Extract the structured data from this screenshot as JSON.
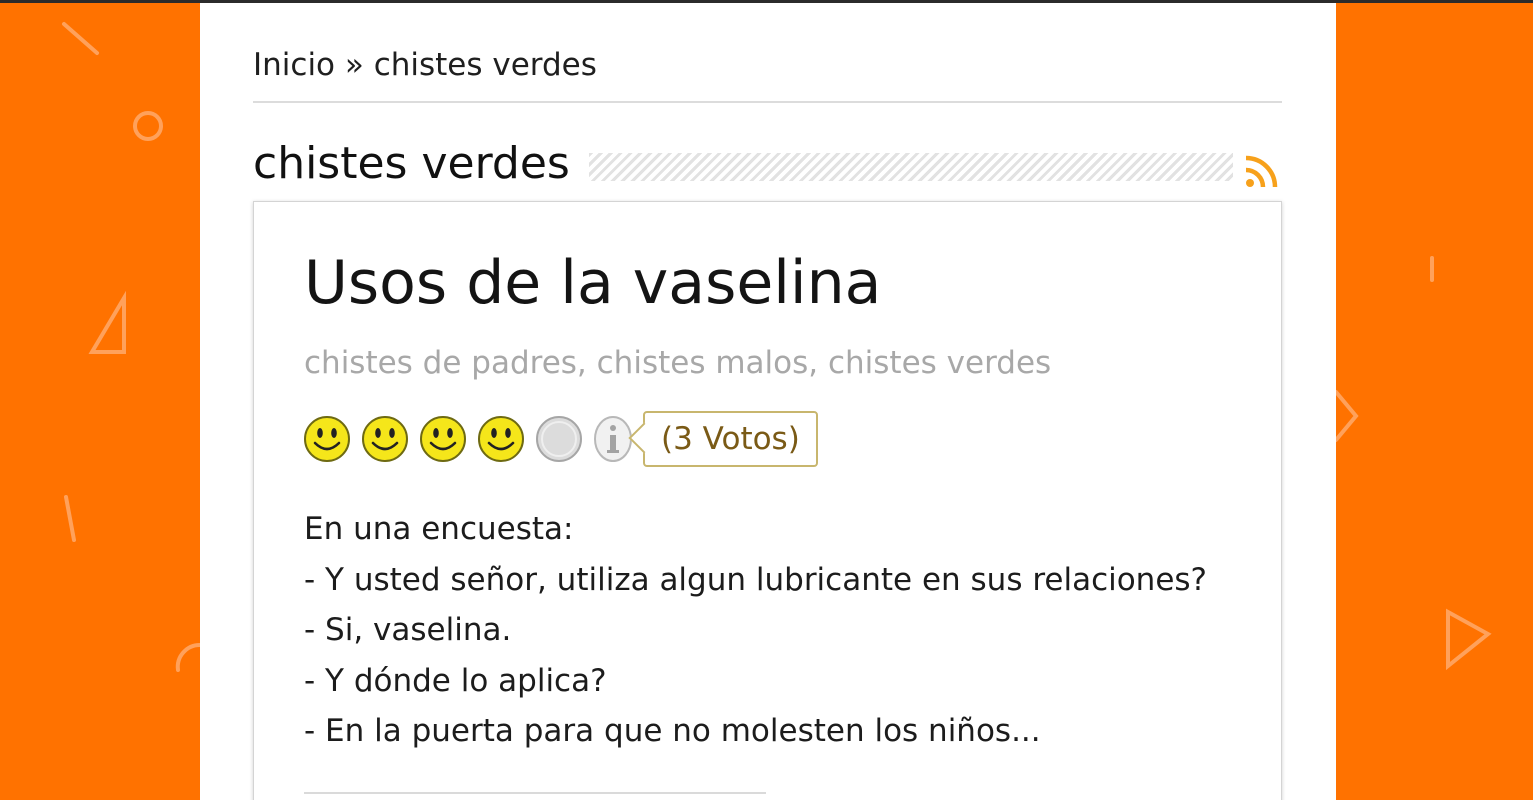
{
  "colors": {
    "background": "#ff7200",
    "panel": "#ffffff",
    "rss": "#f7a11b",
    "smiley_active": "#f5e61a",
    "smiley_inactive": "#d9d9d9",
    "votes_text": "#7a5a16",
    "votes_border": "#c8b66e"
  },
  "breadcrumb": {
    "text": "Inicio » chistes verdes"
  },
  "section": {
    "title": "chistes verdes",
    "feed_icon": "rss-icon"
  },
  "joke": {
    "title": "Usos de la vaselina",
    "tags": "chistes de padres, chistes malos, chistes verdes",
    "rating": {
      "score": 4,
      "max": 5,
      "icon": "smiley-icon",
      "info_icon": "info-icon",
      "votes_label": "(3 Votos)"
    },
    "lines": [
      "En una encuesta:",
      "- Y usted señor, utiliza algun lubricante en sus relaciones?",
      "- Si, vaselina.",
      "- Y dónde lo aplica?",
      "- En la puerta para que no molesten los niños..."
    ]
  }
}
